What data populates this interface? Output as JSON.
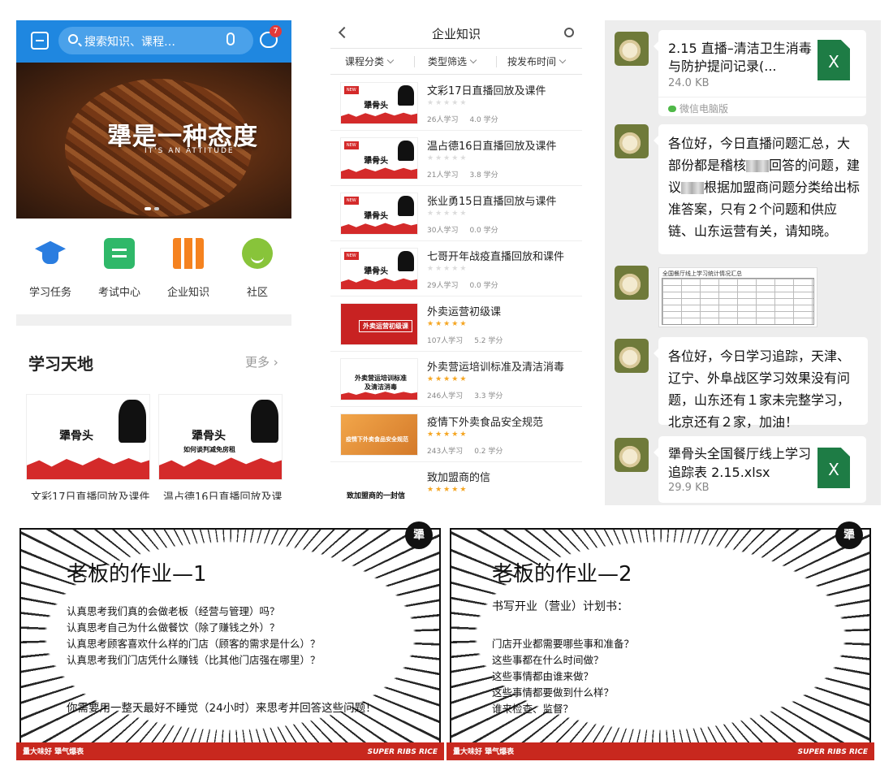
{
  "home": {
    "search_placeholder": "搜索知识、课程…",
    "message_badge": "7",
    "banner_slogan": "犟是一种态度",
    "banner_slogan_en": "IT'S AN ATTITUDE",
    "nav": [
      {
        "label": "学习任务",
        "icon": "graduation-cap-icon"
      },
      {
        "label": "考试中心",
        "icon": "exam-document-icon"
      },
      {
        "label": "企业知识",
        "icon": "books-icon"
      },
      {
        "label": "社区",
        "icon": "community-chat-icon"
      }
    ],
    "section_title": "学习天地",
    "section_more": "更多",
    "cards": [
      {
        "caption": "文彩17日直播回放及课件"
      },
      {
        "caption": "温占德16日直播回放及课"
      }
    ],
    "card_logo": "犟骨头",
    "card_sub": "如何谈判减免房租",
    "colors": {
      "topbar": "#1f87e0",
      "brand_red": "#d42a2a"
    }
  },
  "knowledge": {
    "title": "企业知识",
    "filters": [
      "课程分类",
      "类型筛选",
      "按发布时间"
    ],
    "courses": [
      {
        "name": "文彩17日直播回放及课件",
        "rating": 0,
        "learners": "26人学习",
        "credits": "4.0 学分",
        "thumb_text": "犟骨头"
      },
      {
        "name": "温占德16日直播回放及课件",
        "rating": 0,
        "learners": "21人学习",
        "credits": "3.8 学分",
        "thumb_text": "犟骨头"
      },
      {
        "name": "张业勇15日直播回放与课件",
        "rating": 0,
        "learners": "30人学习",
        "credits": "0.0 学分",
        "thumb_text": "犟骨头"
      },
      {
        "name": "七哥开年战疫直播回放和课件",
        "rating": 0,
        "learners": "29人学习",
        "credits": "0.0 学分",
        "thumb_text": "犟骨头"
      },
      {
        "name": "外卖运营初级课",
        "rating": 5,
        "learners": "107人学习",
        "credits": "5.2 学分",
        "thumb_text": "外卖运营初级课"
      },
      {
        "name": "外卖营运培训标准及清洁消毒",
        "rating": 5,
        "learners": "246人学习",
        "credits": "3.3 学分",
        "thumb_text": "外卖营运培训标准及清洁消毒"
      },
      {
        "name": "疫情下外卖食品安全规范",
        "rating": 5,
        "learners": "243人学习",
        "credits": "0.2 学分",
        "thumb_text": "疫情下外卖食品安全规范"
      },
      {
        "name": "致加盟商的信",
        "rating": 5,
        "learners": "",
        "credits": "",
        "thumb_text": "致加盟商的一封信"
      }
    ]
  },
  "chat": {
    "file1": {
      "name": "2.15 直播–清洁卫生消毒与防护提问记录(...",
      "size": "24.0 KB",
      "source": "微信电脑版",
      "ext": "X"
    },
    "msg1_parts": [
      "各位好，今日直播问题汇总，大部份都是稽核",
      "回答的问题，建议",
      "根据加盟商问题分类给出标准答案，只有２个问题和供应链、山东运营有关，请知晓。"
    ],
    "sheet_title": "全国餐厅线上学习统计情况汇总",
    "msg2": "各位好，今日学习追踪，天津、辽宁、外阜战区学习效果没有问题，山东还有１家未完整学习，北京还有２家，加油！",
    "file2": {
      "name": "犟骨头全国餐厅线上学习追踪表 2.15.xlsx",
      "size": "29.9 KB",
      "ext": "X"
    }
  },
  "slides": [
    {
      "title": "老板的作业—1",
      "lines": [
        "认真思考我们真的会做老板（经营与管理）吗？",
        "认真思考自己为什么做餐饮（除了赚钱之外）？",
        "认真思考顾客喜欢什么样的门店（顾客的需求是什么）？",
        "认真思考我们门店凭什么赚钱（比其他门店强在哪里）？"
      ],
      "closing": "你需要用一整天最好不睡觉（24小时）来思考并回答这些问题！"
    },
    {
      "title": "老板的作业—2",
      "subtitle": "书写开业（营业）计划书：",
      "lines": [
        "门店开业都需要哪些事和准备？",
        "这些事都在什么时间做？",
        "这些事情都由谁来做？",
        "这些事情都要做到什么样？",
        "谁来检查、监督？"
      ]
    }
  ],
  "slide_footer": {
    "left": "量大味好 犟气爆表",
    "right": "SUPER RIBS RICE",
    "corner": "犟"
  }
}
